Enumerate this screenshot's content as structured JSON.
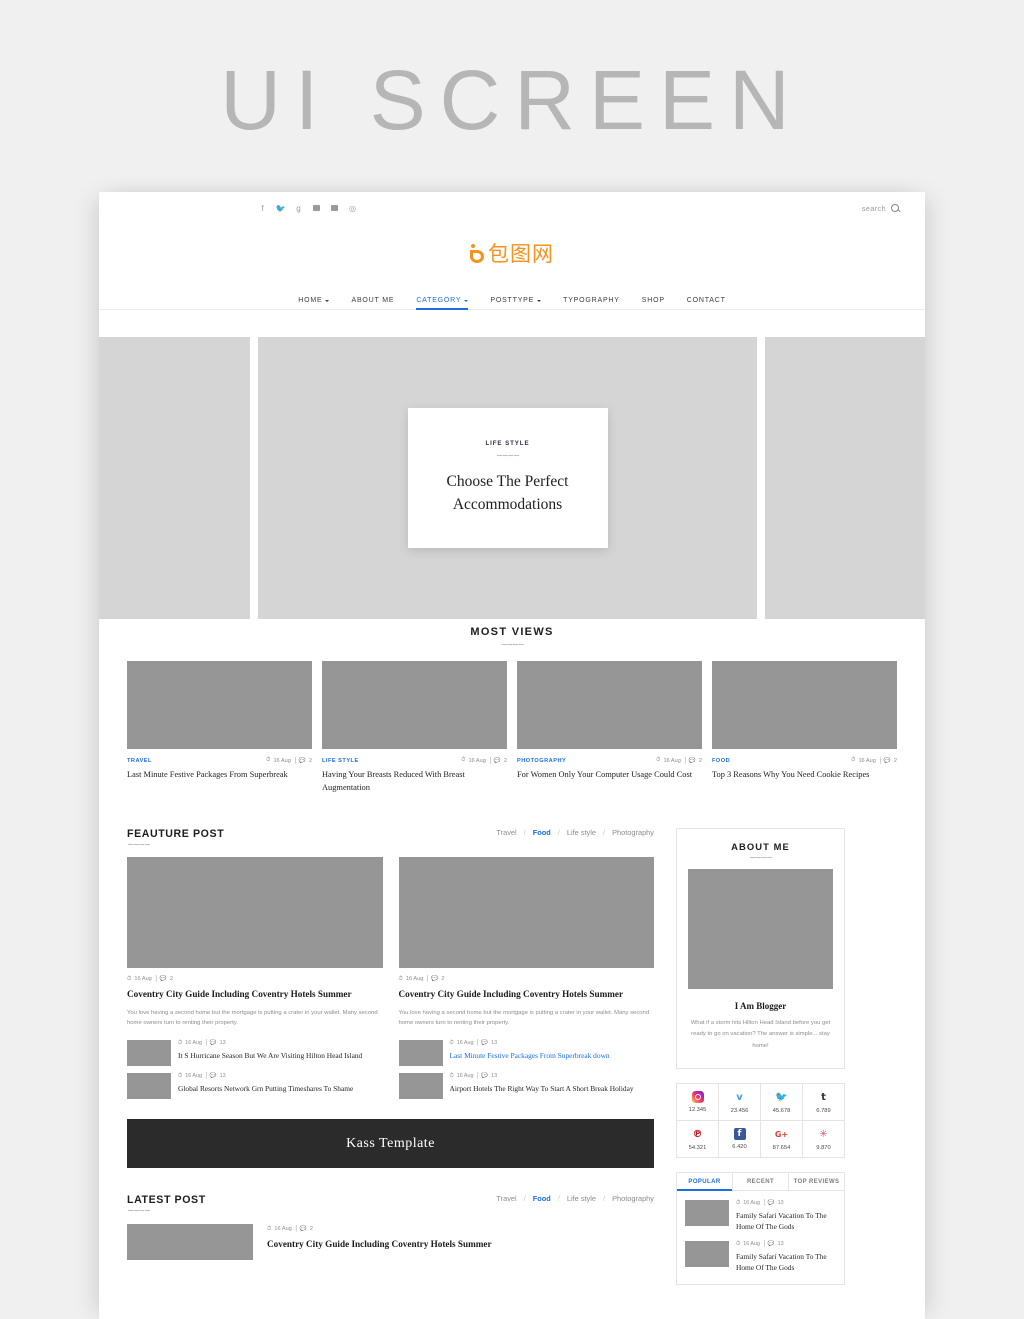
{
  "watermark": "UI SCREEN",
  "topbar": {
    "social_icons": [
      "facebook-icon",
      "twitter-icon",
      "google-plus-icon",
      "flickr-icon",
      "youtube-icon",
      "pinterest-icon"
    ],
    "search_label": "search"
  },
  "logo": {
    "mark": "b",
    "text": "包图网"
  },
  "nav": [
    {
      "label": "HOME",
      "caret": true,
      "active": false
    },
    {
      "label": "ABOUT ME",
      "caret": false,
      "active": false
    },
    {
      "label": "CATEGORY",
      "caret": true,
      "active": true
    },
    {
      "label": "POSTTYPE",
      "caret": true,
      "active": false
    },
    {
      "label": "TYPOGRAPHY",
      "caret": false,
      "active": false
    },
    {
      "label": "SHOP",
      "caret": false,
      "active": false
    },
    {
      "label": "CONTACT",
      "caret": false,
      "active": false
    }
  ],
  "hero": {
    "category": "LIFE STYLE",
    "title_line1": "Choose The Perfect",
    "title_line2": "Accommodations"
  },
  "most_views": {
    "heading": "MOST VIEWS",
    "cards": [
      {
        "category": "TRAVEL",
        "date": "16 Aug",
        "comments": "2",
        "title": "Last Minute Festive Packages From Superbreak"
      },
      {
        "category": "LIFE STYLE",
        "date": "16 Aug",
        "comments": "2",
        "title": "Having Your Breasts Reduced With Breast Augmentation"
      },
      {
        "category": "PHOTOGRAPHY",
        "date": "16 Aug",
        "comments": "2",
        "title": "For Women Only Your Computer Usage Could Cost"
      },
      {
        "category": "FOOD",
        "date": "16 Aug",
        "comments": "2",
        "title": "Top 3 Reasons Why You Need Cookie Recipes"
      }
    ]
  },
  "feature_post": {
    "heading": "FEAUTURE POST",
    "filters": [
      "Travel",
      "Food",
      "Life style",
      "Photography"
    ],
    "active_filter": "Food",
    "posts": [
      {
        "date": "16 Aug",
        "comments": "2",
        "title": "Coventry City Guide Including Coventry Hotels Summer",
        "excerpt": "You love having a second home but the mortgage is putting a crater in your wallet. Many second home owners turn to renting their property."
      },
      {
        "date": "16 Aug",
        "comments": "2",
        "title": "Coventry City Guide Including Coventry Hotels Summer",
        "excerpt": "You love having a second home but the mortgage is putting a crater in your wallet. Many second home owners turn to renting their property."
      }
    ],
    "mini_left": [
      {
        "date": "16 Aug",
        "comments": "13",
        "title": "It S Hurricane Season But We Are Visiting Hilton Head Island",
        "highlight": false
      },
      {
        "date": "16 Aug",
        "comments": "13",
        "title": "Global Resorts Network Grn Putting Timeshares To Shame",
        "highlight": false
      }
    ],
    "mini_right": [
      {
        "date": "16 Aug",
        "comments": "13",
        "title": "Last Minute Festive Packages From Superbreak down",
        "highlight": true
      },
      {
        "date": "16 Aug",
        "comments": "13",
        "title": "Airport Hotels The Right Way To Start A Short Break Holiday",
        "highlight": false
      }
    ]
  },
  "banner": {
    "text": "Kass Template"
  },
  "latest_post": {
    "heading": "LATEST POST",
    "filters": [
      "Travel",
      "Food",
      "Life style",
      "Photography"
    ],
    "active_filter": "Food",
    "items": [
      {
        "date": "16 Aug",
        "comments": "2",
        "title": "Coventry City Guide Including Coventry Hotels Summer"
      }
    ]
  },
  "sidebar": {
    "about": {
      "heading": "ABOUT ME",
      "name": "I Am Blogger",
      "text": "What if a storm hits Hilton Head Island before you get ready to go on vacation? The answer is simple... stay home!"
    },
    "social_counts": [
      {
        "icon": "instagram-icon",
        "glyph": "",
        "count": "12.345",
        "color": "#e1306c"
      },
      {
        "icon": "vimeo-icon",
        "glyph": "𝐯",
        "count": "23.456",
        "color": "#4a9fdc"
      },
      {
        "icon": "twitter-icon",
        "glyph": "🐦",
        "count": "45.678",
        "color": "#1da1f2"
      },
      {
        "icon": "tumblr-icon",
        "glyph": "t",
        "count": "6.789",
        "color": "#2b3440"
      },
      {
        "icon": "pinterest-icon",
        "glyph": "℗",
        "count": "54.321",
        "color": "#bd081c"
      },
      {
        "icon": "facebook-icon",
        "glyph": "f",
        "count": "6.420",
        "color": "#3b5998"
      },
      {
        "icon": "google-plus-icon",
        "glyph": "G+",
        "count": "87.654",
        "color": "#db4437"
      },
      {
        "icon": "dribbble-icon",
        "glyph": "✳",
        "count": "9.870",
        "color": "#ea4c89"
      }
    ],
    "tabs": [
      {
        "label": "POPULAR",
        "active": true
      },
      {
        "label": "RECENT",
        "active": false
      },
      {
        "label": "TOP REVIEWS",
        "active": false
      }
    ],
    "tab_items": [
      {
        "date": "16 Aug",
        "comments": "13",
        "title": "Family Safari Vacation To The Home Of The Gods"
      },
      {
        "date": "16 Aug",
        "comments": "13",
        "title": "Family Safari Vacation To The Home Of The Gods"
      }
    ]
  },
  "colors": {
    "accent": "#1b6fe0",
    "brand": "#f6921e",
    "placeholder": "#969696",
    "hero_slide": "#d5d5d5"
  }
}
